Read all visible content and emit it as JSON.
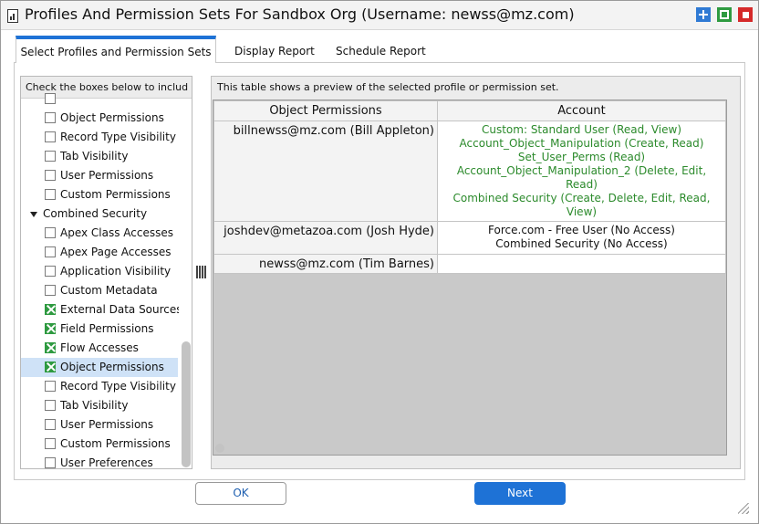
{
  "window": {
    "title": "Profiles And Permission Sets For Sandbox Org (Username: newss@mz.com)",
    "controls": {
      "maximize_icon": "plus-icon",
      "restore_icon": "square-icon",
      "close_icon": "stop-icon"
    },
    "colors": {
      "maximize": "#2f7ad4",
      "restore": "#2e9a40",
      "close": "#d52a2a"
    }
  },
  "tabs": [
    {
      "label": "Select Profiles and Permission Sets",
      "active": true
    },
    {
      "label": "Display Report",
      "active": false
    },
    {
      "label": "Schedule Report",
      "active": false
    }
  ],
  "left": {
    "header": "Check the boxes below to includ",
    "items": [
      {
        "label": "",
        "checked": false,
        "type": "checkbox"
      },
      {
        "label": "Object Permissions",
        "checked": false,
        "type": "checkbox"
      },
      {
        "label": "Record Type Visibility",
        "checked": false,
        "type": "checkbox"
      },
      {
        "label": "Tab Visibility",
        "checked": false,
        "type": "checkbox"
      },
      {
        "label": "User Permissions",
        "checked": false,
        "type": "checkbox"
      },
      {
        "label": "Custom Permissions",
        "checked": false,
        "type": "checkbox"
      },
      {
        "label": "Combined Security",
        "type": "group",
        "expanded": true
      },
      {
        "label": "Apex Class Accesses",
        "checked": false,
        "type": "checkbox"
      },
      {
        "label": "Apex Page Accesses",
        "checked": false,
        "type": "checkbox"
      },
      {
        "label": "Application Visibility",
        "checked": false,
        "type": "checkbox"
      },
      {
        "label": "Custom Metadata",
        "checked": false,
        "type": "checkbox"
      },
      {
        "label": "External Data Sources",
        "checked": true,
        "type": "checkbox"
      },
      {
        "label": "Field Permissions",
        "checked": true,
        "type": "checkbox"
      },
      {
        "label": "Flow Accesses",
        "checked": true,
        "type": "checkbox"
      },
      {
        "label": "Object Permissions",
        "checked": true,
        "type": "checkbox",
        "selected": true
      },
      {
        "label": "Record Type Visibility",
        "checked": false,
        "type": "checkbox"
      },
      {
        "label": "Tab Visibility",
        "checked": false,
        "type": "checkbox"
      },
      {
        "label": "User Permissions",
        "checked": false,
        "type": "checkbox"
      },
      {
        "label": "Custom Permissions",
        "checked": false,
        "type": "checkbox"
      },
      {
        "label": "User Preferences",
        "checked": false,
        "type": "checkbox"
      }
    ]
  },
  "right": {
    "header": "This table shows a preview of the selected profile or permission set.",
    "columns": [
      "Object Permissions",
      "Account"
    ],
    "rows": [
      {
        "name": "billnewss@mz.com (Bill Appleton)",
        "values": [
          "Custom: Standard User (Read, View)",
          "Account_Object_Manipulation (Create, Read)",
          "Set_User_Perms (Read)",
          "Account_Object_Manipulation_2 (Delete, Edit, Read)",
          "Combined Security (Create, Delete, Edit, Read, View)"
        ],
        "color": "#2b8a2b"
      },
      {
        "name": "joshdev@metazoa.com (Josh Hyde)",
        "values": [
          "Force.com - Free User (No Access)",
          "Combined Security (No Access)"
        ],
        "color": "#111111"
      },
      {
        "name": "newss@mz.com (Tim Barnes)",
        "values": [],
        "color": "#111111"
      }
    ]
  },
  "buttons": {
    "ok": "OK",
    "next": "Next"
  }
}
